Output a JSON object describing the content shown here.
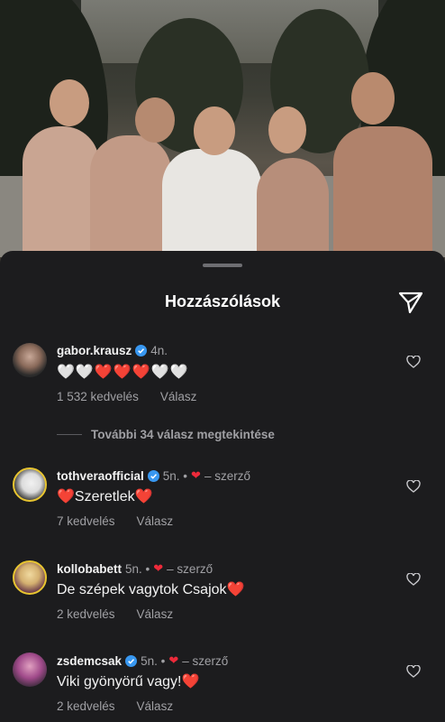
{
  "sheet": {
    "title": "Hozzászólások",
    "more_replies": "További 34 válasz megtekintése"
  },
  "comments": [
    {
      "username": "gabor.krausz",
      "verified": true,
      "time": "4n.",
      "text": "🤍🤍❤️❤️❤️🤍🤍",
      "likes": "1 532 kedvelés",
      "reply": "Válasz"
    },
    {
      "username": "tothveraofficial",
      "verified": true,
      "time": "5n. •",
      "author_label": "– szerző",
      "text": "❤️Szeretlek❤️",
      "likes": "7 kedvelés",
      "reply": "Válasz"
    },
    {
      "username": "kollobabett",
      "verified": false,
      "time": "5n. •",
      "author_label": "– szerző",
      "text": "De szépek vagytok Csajok❤️",
      "likes": "2 kedvelés",
      "reply": "Válasz"
    },
    {
      "username": "zsdemcsak",
      "verified": true,
      "time": "5n. •",
      "author_label": "– szerző",
      "text": "Viki gyönyörű vagy!❤️",
      "likes": "2 kedvelés",
      "reply": "Válasz"
    }
  ],
  "colors": {
    "sheet_bg": "#1c1c1e",
    "secondary_text": "#a0a0a4",
    "heart": "#ed2a3a",
    "verified": "#3897f0"
  },
  "icons": {
    "send": "send-icon",
    "like": "heart-outline-icon",
    "verified": "verified-badge-icon"
  }
}
